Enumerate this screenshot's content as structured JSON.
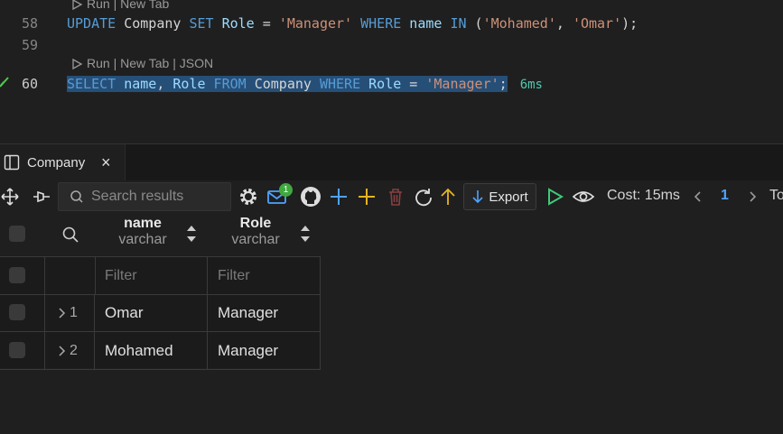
{
  "editor": {
    "codelens_top": "Run | New Tab",
    "codelens_bottom": "Run | New Tab | JSON",
    "lines": [
      {
        "number": "58",
        "tokens": [
          {
            "t": "UPDATE",
            "c": "kw"
          },
          {
            "t": " Company ",
            "c": "plain"
          },
          {
            "t": "SET",
            "c": "kw"
          },
          {
            "t": " Role",
            "c": "id"
          },
          {
            "t": " = ",
            "c": "plain"
          },
          {
            "t": "'Manager'",
            "c": "str"
          },
          {
            "t": " WHERE",
            "c": "kw"
          },
          {
            "t": " name",
            "c": "id"
          },
          {
            "t": " IN",
            "c": "kw"
          },
          {
            "t": " (",
            "c": "plain"
          },
          {
            "t": "'Mohamed'",
            "c": "str"
          },
          {
            "t": ", ",
            "c": "plain"
          },
          {
            "t": "'Omar'",
            "c": "str"
          },
          {
            "t": ");",
            "c": "plain"
          }
        ]
      },
      {
        "number": "59",
        "tokens": []
      },
      {
        "number": "60",
        "tokens": [
          {
            "t": "SELECT",
            "c": "kw"
          },
          {
            "t": " name",
            "c": "id"
          },
          {
            "t": ", ",
            "c": "plain"
          },
          {
            "t": "Role",
            "c": "id"
          },
          {
            "t": " FROM",
            "c": "kw"
          },
          {
            "t": " Company ",
            "c": "plain"
          },
          {
            "t": "WHERE",
            "c": "kw"
          },
          {
            "t": " Role",
            "c": "id"
          },
          {
            "t": " = ",
            "c": "plain"
          },
          {
            "t": "'Manager'",
            "c": "str"
          },
          {
            "t": ";",
            "c": "plain"
          }
        ]
      }
    ],
    "exec_time": "6ms"
  },
  "tab": {
    "title": "Company",
    "close": "×"
  },
  "toolbar": {
    "search_placeholder": "Search results",
    "badge_count": "1",
    "export_label": "Export",
    "cost": "Cost: 15ms",
    "page": "1",
    "to_label": "To",
    "icons": [
      "move-icon",
      "pin-icon",
      "search-icon",
      "gear-icon",
      "mail-icon",
      "github-icon",
      "plus-icon",
      "plus-yellow-icon",
      "trash-icon",
      "refresh-icon",
      "arrow-up-icon",
      "download-icon",
      "play-icon",
      "eye-icon",
      "chevron-left-icon",
      "chevron-right-icon"
    ]
  },
  "grid": {
    "columns": [
      {
        "name": "name",
        "type": "varchar"
      },
      {
        "name": "Role",
        "type": "varchar"
      }
    ],
    "filter_placeholder": "Filter",
    "rows": [
      {
        "index": "1",
        "name": "Omar",
        "role": "Manager"
      },
      {
        "index": "2",
        "name": "Mohamed",
        "role": "Manager"
      }
    ]
  },
  "colors": {
    "keyword": "#569cd6",
    "identifier": "#9cdcfe",
    "string": "#ce9178",
    "accent": "#4fa3ff",
    "success": "#3fa83f"
  }
}
